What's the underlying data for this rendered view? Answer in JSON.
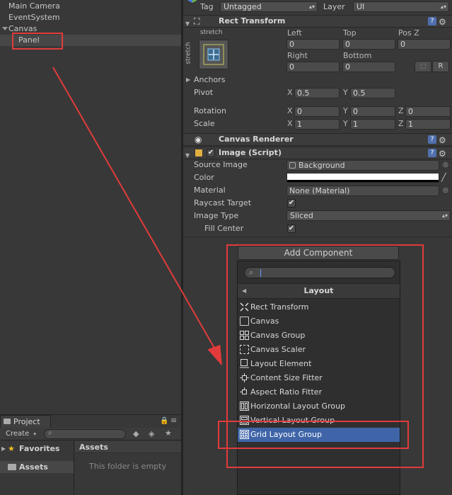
{
  "hierarchy": {
    "items": [
      {
        "label": "Main Camera"
      },
      {
        "label": "EventSystem"
      },
      {
        "label": "Canvas"
      },
      {
        "label": "Panel"
      }
    ]
  },
  "project": {
    "tab_label": "Project",
    "create_label": "Create",
    "favorites_label": "Favorites",
    "assets_label": "Assets",
    "assets_header": "Assets",
    "empty_text": "This folder is empty"
  },
  "inspector": {
    "tag_label": "Tag",
    "tag_value": "Untagged",
    "layer_label": "Layer",
    "layer_value": "UI",
    "rect_transform": {
      "title": "Rect Transform",
      "stretch_top": "stretch",
      "stretch_side": "stretch",
      "left_label": "Left",
      "top_label": "Top",
      "posz_label": "Pos Z",
      "right_label": "Right",
      "bottom_label": "Bottom",
      "left_value": "0",
      "top_value": "0",
      "posz_value": "0",
      "right_value": "0",
      "bottom_value": "0",
      "r_button": "R",
      "anchors_label": "Anchors",
      "pivot_label": "Pivot",
      "pivot_x": "0.5",
      "pivot_y": "0.5",
      "rotation_label": "Rotation",
      "rot_x": "0",
      "rot_y": "0",
      "rot_z": "0",
      "scale_label": "Scale",
      "scale_x": "1",
      "scale_y": "1",
      "scale_z": "1",
      "x": "X",
      "y": "Y",
      "z": "Z"
    },
    "canvas_renderer": {
      "title": "Canvas Renderer"
    },
    "image": {
      "title": "Image (Script)",
      "source_image_label": "Source Image",
      "source_image_value": "Background",
      "color_label": "Color",
      "material_label": "Material",
      "material_value": "None (Material)",
      "raycast_label": "Raycast Target",
      "image_type_label": "Image Type",
      "image_type_value": "Sliced",
      "fill_center_label": "Fill Center"
    }
  },
  "add_component": {
    "button_label": "Add Component",
    "search_placeholder": "",
    "category": "Layout",
    "items": [
      {
        "label": "Rect Transform",
        "icon": "rect-transform-icon"
      },
      {
        "label": "Canvas",
        "icon": "canvas-icon"
      },
      {
        "label": "Canvas Group",
        "icon": "canvas-group-icon"
      },
      {
        "label": "Canvas Scaler",
        "icon": "canvas-scaler-icon"
      },
      {
        "label": "Layout Element",
        "icon": "layout-element-icon"
      },
      {
        "label": "Content Size Fitter",
        "icon": "content-size-fitter-icon"
      },
      {
        "label": "Aspect Ratio Fitter",
        "icon": "aspect-ratio-fitter-icon"
      },
      {
        "label": "Horizontal Layout Group",
        "icon": "horizontal-layout-icon"
      },
      {
        "label": "Vertical Layout Group",
        "icon": "vertical-layout-icon"
      },
      {
        "label": "Grid Layout Group",
        "icon": "grid-layout-icon"
      }
    ],
    "selected_item": "Grid Layout Group"
  },
  "colors": {
    "panel_bg": "#383838",
    "highlight": "#3f65a8",
    "annotation_red": "#e23b3b"
  }
}
